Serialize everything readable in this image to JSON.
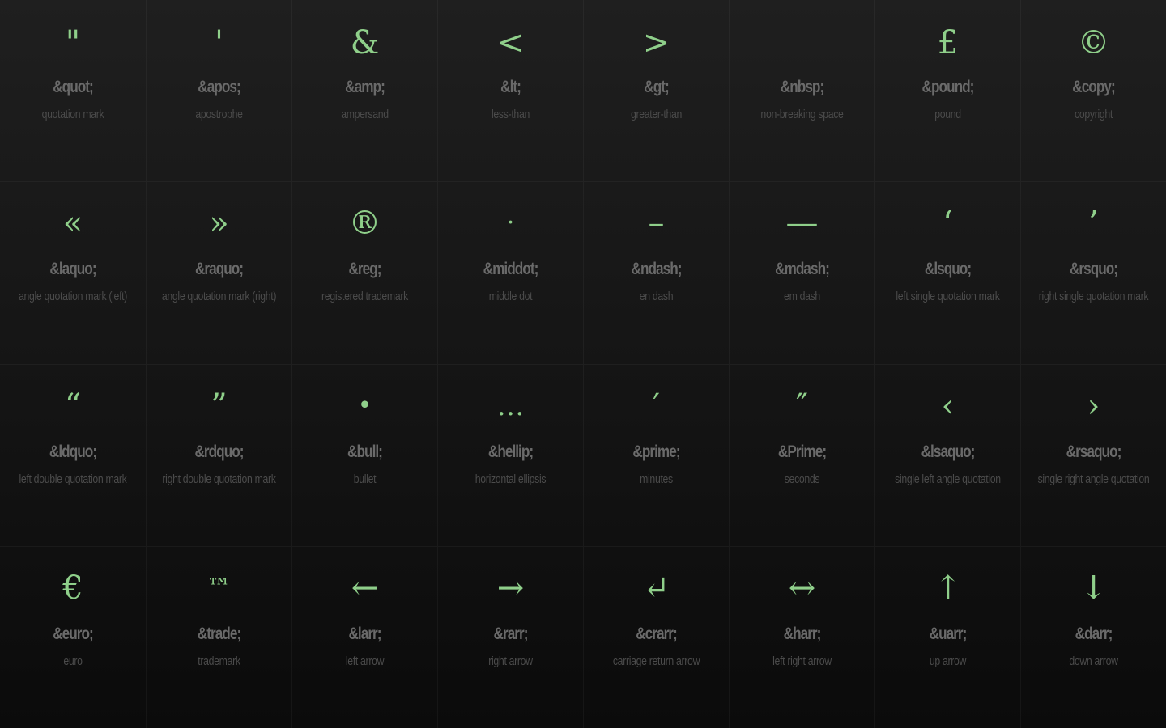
{
  "entities": [
    {
      "glyph": "\"",
      "code": "&quot;",
      "name": "quotation mark"
    },
    {
      "glyph": "'",
      "code": "&apos;",
      "name": "apostrophe"
    },
    {
      "glyph": "&",
      "code": "&amp;",
      "name": "ampersand"
    },
    {
      "glyph": "<",
      "code": "&lt;",
      "name": "less-than"
    },
    {
      "glyph": ">",
      "code": "&gt;",
      "name": "greater-than"
    },
    {
      "glyph": " ",
      "code": "&nbsp;",
      "name": "non-breaking space"
    },
    {
      "glyph": "£",
      "code": "&pound;",
      "name": "pound"
    },
    {
      "glyph": "©",
      "code": "&copy;",
      "name": "copyright"
    },
    {
      "glyph": "«",
      "code": "&laquo;",
      "name": "angle quotation mark (left)"
    },
    {
      "glyph": "»",
      "code": "&raquo;",
      "name": "angle quotation mark (right)"
    },
    {
      "glyph": "®",
      "code": "&reg;",
      "name": "registered trademark"
    },
    {
      "glyph": "·",
      "code": "&middot;",
      "name": "middle dot"
    },
    {
      "glyph": "–",
      "code": "&ndash;",
      "name": "en dash"
    },
    {
      "glyph": "—",
      "code": "&mdash;",
      "name": "em dash"
    },
    {
      "glyph": "‘",
      "code": "&lsquo;",
      "name": "left single quotation mark"
    },
    {
      "glyph": "’",
      "code": "&rsquo;",
      "name": "right single quotation mark"
    },
    {
      "glyph": "“",
      "code": "&ldquo;",
      "name": "left double quotation mark"
    },
    {
      "glyph": "”",
      "code": "&rdquo;",
      "name": "right double quotation mark"
    },
    {
      "glyph": "•",
      "code": "&bull;",
      "name": "bullet"
    },
    {
      "glyph": "…",
      "code": "&hellip;",
      "name": "horizontal ellipsis"
    },
    {
      "glyph": "′",
      "code": "&prime;",
      "name": "minutes"
    },
    {
      "glyph": "″",
      "code": "&Prime;",
      "name": "seconds"
    },
    {
      "glyph": "‹",
      "code": "&lsaquo;",
      "name": "single left angle quotation"
    },
    {
      "glyph": "›",
      "code": "&rsaquo;",
      "name": "single right angle quotation"
    },
    {
      "glyph": "€",
      "code": "&euro;",
      "name": "euro"
    },
    {
      "glyph": "™",
      "code": "&trade;",
      "name": "trademark"
    },
    {
      "glyph": "←",
      "code": "&larr;",
      "name": "left arrow"
    },
    {
      "glyph": "→",
      "code": "&rarr;",
      "name": "right arrow"
    },
    {
      "glyph": "↵",
      "code": "&crarr;",
      "name": "carriage return arrow"
    },
    {
      "glyph": "↔",
      "code": "&harr;",
      "name": "left right arrow"
    },
    {
      "glyph": "↑",
      "code": "&uarr;",
      "name": "up arrow"
    },
    {
      "glyph": "↓",
      "code": "&darr;",
      "name": "down arrow"
    }
  ],
  "colors": {
    "glyph": "#8fcf8a",
    "code": "#6a6a6a",
    "name": "#4b4b4b",
    "background": "#141414"
  }
}
